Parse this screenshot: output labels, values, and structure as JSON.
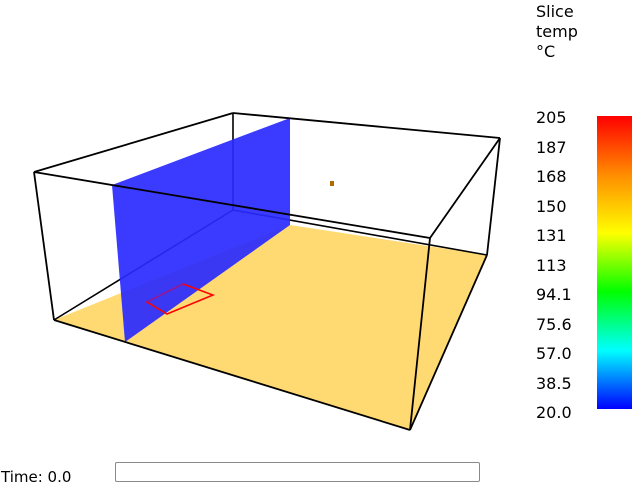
{
  "colorbar": {
    "title_lines": [
      "Slice",
      "temp",
      "°C"
    ],
    "ticks": [
      "205",
      "187",
      "168",
      "150",
      "131",
      "113",
      "94.1",
      "75.6",
      "57.0",
      "38.5",
      "20.0"
    ],
    "gradient_colors": [
      "#ff0000",
      "#ff8c00",
      "#ffff00",
      "#00ff00",
      "#00ffff",
      "#0000ff"
    ]
  },
  "scene": {
    "floor_color": "#ffd971",
    "slice_color": "#2a2aff",
    "outline_color": "#000000",
    "vent_color": "#ff0000",
    "marker_color": "#b06a00"
  },
  "time": {
    "label": "Time:",
    "value": "0.0"
  }
}
